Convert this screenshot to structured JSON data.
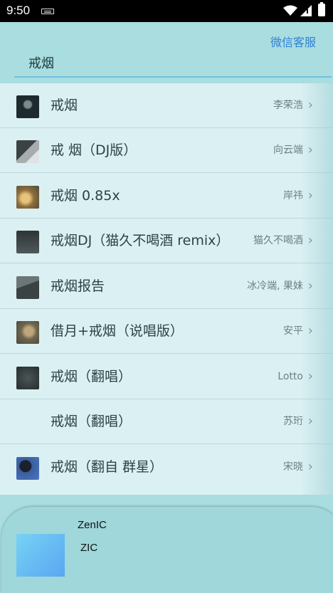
{
  "status_bar": {
    "time": "9:50"
  },
  "header": {
    "service_link": "微信客服",
    "search_value": "戒烟"
  },
  "results": [
    {
      "title": "戒烟",
      "artist": "李荣浩",
      "thumb_color": "#1e2b2e"
    },
    {
      "title": "戒 烟（DJ版）",
      "artist": "向云端",
      "thumb_color": "#7d8486"
    },
    {
      "title": "戒烟 0.85x",
      "artist": "岸祎",
      "thumb_color": "#c9a063"
    },
    {
      "title": "戒烟DJ（猫久不喝酒 remix）",
      "artist": "猫久不喝酒",
      "thumb_color": "#3c4446"
    },
    {
      "title": "戒烟报告",
      "artist": "冰冷端, 果妹",
      "thumb_color": "#4f5a5c"
    },
    {
      "title": "借月+戒烟（说唱版）",
      "artist": "安平",
      "thumb_color": "#6f6650"
    },
    {
      "title": "戒烟（翻唱）",
      "artist": "Lotto",
      "thumb_color": "#333b3c"
    },
    {
      "title": "戒烟（翻唱）",
      "artist": "苏珩",
      "thumb_color": ""
    },
    {
      "title": "戒烟（翻自 群星）",
      "artist": "宋晓",
      "thumb_color": "#3a5e9c"
    }
  ],
  "player": {
    "title": "ZenIC",
    "artist": "ZIC"
  }
}
